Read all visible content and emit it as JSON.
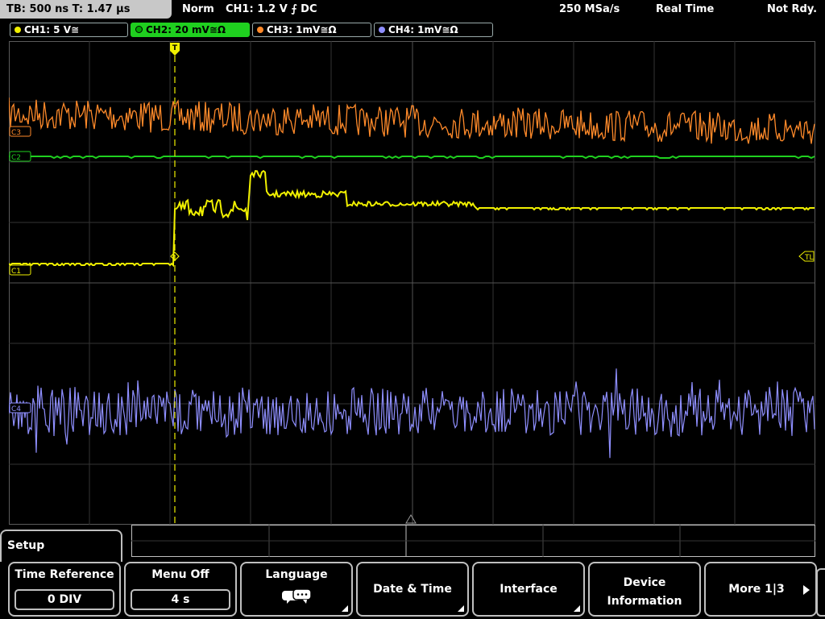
{
  "status": {
    "timebase": "TB: 500 ns   T: 1.47 µs",
    "mode": "Norm",
    "trigger": "CH1: 1.2 V ⨍ DC",
    "sample_rate": "250 MSa/s",
    "acq_mode": "Real Time",
    "state": "Not Rdy."
  },
  "channels": [
    {
      "label": "CH1: 5 V≅",
      "color": "#f0f000"
    },
    {
      "label": "CH2: 20 mV≅Ω",
      "color": "#1fd01f"
    },
    {
      "label": "CH3: 1mV≅Ω",
      "color": "#ff8a2a"
    },
    {
      "label": "CH4: 1mV≅Ω",
      "color": "#8f8fff"
    }
  ],
  "markers": {
    "c3": "C3",
    "c2": "C2",
    "c1": "C1",
    "c4": "C4",
    "tl": "TL"
  },
  "menu": {
    "setup_tab": "Setup",
    "time_reference": {
      "label": "Time Reference",
      "value": "0 DIV"
    },
    "menu_off": {
      "label": "Menu Off",
      "value": "4 s"
    },
    "language": {
      "label": "Language"
    },
    "date_time": {
      "label": "Date & Time"
    },
    "interface": {
      "label": "Interface"
    },
    "device_info": {
      "label": "Device Information",
      "line1": "Device",
      "line2": "Information"
    },
    "more": {
      "label": "More 1|3"
    }
  },
  "colors": {
    "ch1": "#f0f000",
    "ch2": "#1fd01f",
    "ch3": "#ff8a2a",
    "ch4": "#8f8fff",
    "grid": "#4a4a4a",
    "trigger": "#f0f000"
  }
}
